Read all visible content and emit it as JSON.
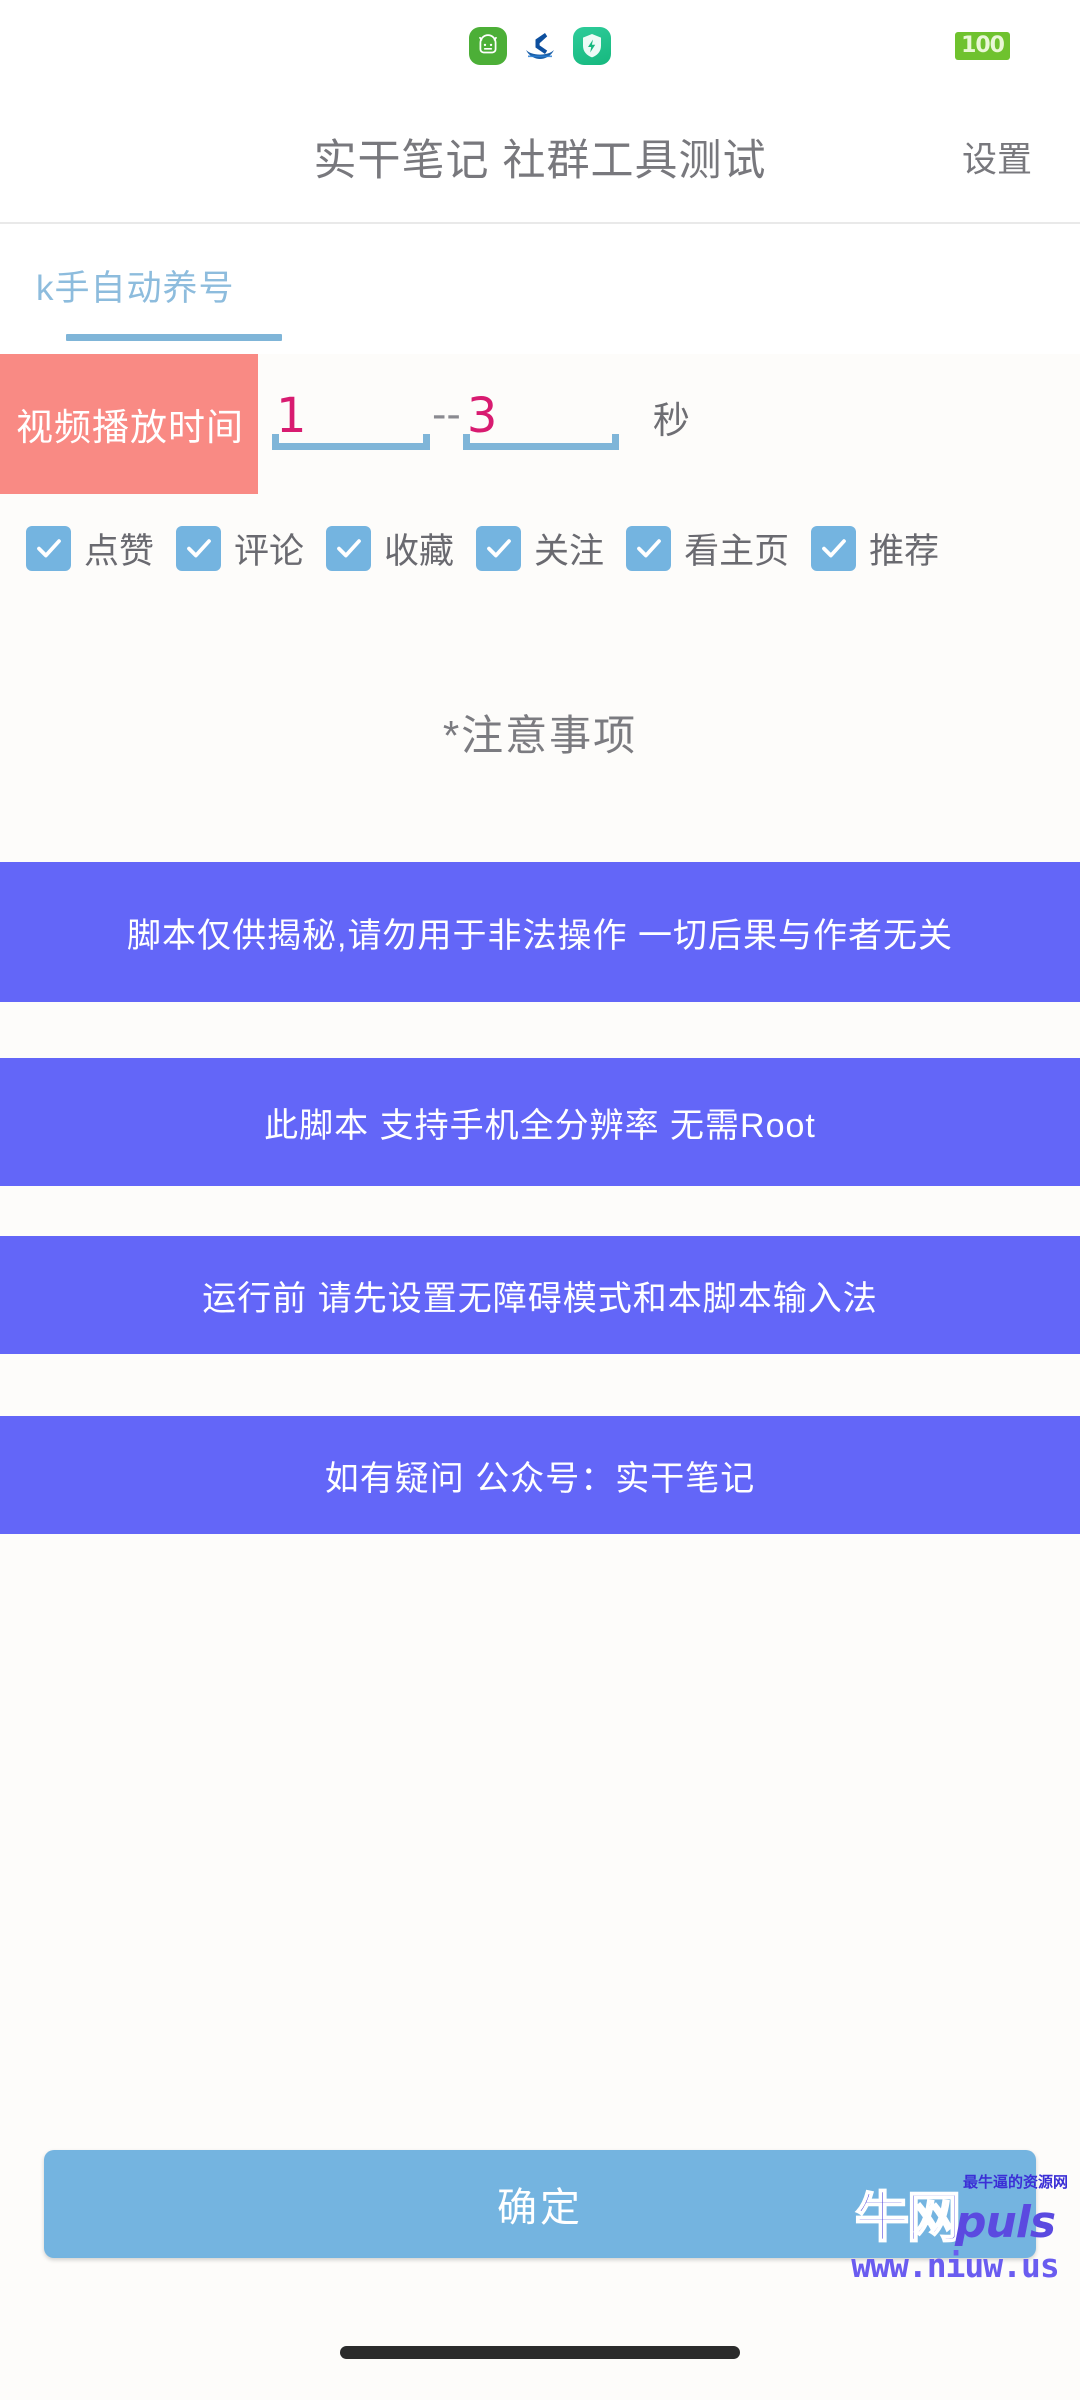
{
  "statusbar": {
    "icons": [
      {
        "name": "android-robot-icon",
        "label": "安卓机器人"
      },
      {
        "name": "ccb-bank-icon",
        "label": "建设银行"
      },
      {
        "name": "security-shield-icon",
        "label": "安全加速"
      }
    ],
    "battery_level": "100"
  },
  "titlebar": {
    "title": "实干笔记 社群工具测试",
    "settings_label": "设置"
  },
  "tabs": [
    {
      "label": "k手自动养号",
      "active": true
    }
  ],
  "time_setting": {
    "label": "视频播放时间",
    "min_value": "1",
    "separator": "--",
    "max_value": "3",
    "unit": "秒",
    "label_bg": "#f98a84",
    "value_color": "#d81b70",
    "underline_color": "#7fb5d8"
  },
  "checkboxes": [
    {
      "label": "点赞",
      "checked": true
    },
    {
      "label": "评论",
      "checked": true
    },
    {
      "label": "收藏",
      "checked": true
    },
    {
      "label": "关注",
      "checked": true
    },
    {
      "label": "看主页",
      "checked": true
    },
    {
      "label": "推荐",
      "checked": true
    }
  ],
  "notice": {
    "heading": "*注意事项",
    "banner_color": "#6366f8",
    "items": [
      "脚本仅供揭秘,请勿用于非法操作 一切后果与作者无关",
      "此脚本 支持手机全分辨率 无需Root",
      "运行前 请先设置无障碍模式和本脚本输入法",
      "如有疑问 公众号：实干笔记"
    ]
  },
  "footer": {
    "confirm_label": "确定",
    "confirm_color": "#74b4e0"
  },
  "watermark": {
    "brand_cn": "牛网",
    "brand_en": "puls",
    "tagline": "最牛逼的资源网",
    "url": "www.niuw.us"
  }
}
